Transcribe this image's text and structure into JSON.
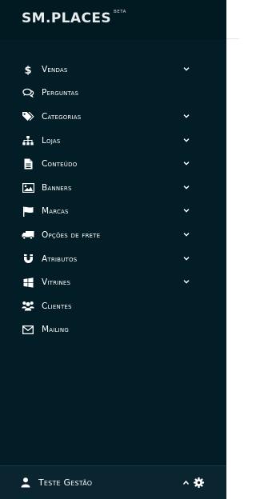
{
  "brand": {
    "logo": "SM.PLACES",
    "badge": "BETA"
  },
  "menu": {
    "items": [
      {
        "label": "Vendas",
        "icon": "dollar-icon",
        "expandable": true
      },
      {
        "label": "Perguntas",
        "icon": "comments-icon",
        "expandable": false
      },
      {
        "label": "Categorias",
        "icon": "tags-icon",
        "expandable": true
      },
      {
        "label": "Lojas",
        "icon": "sitemap-icon",
        "expandable": true
      },
      {
        "label": "Conteúdo",
        "icon": "file-icon",
        "expandable": true
      },
      {
        "label": "Banners",
        "icon": "image-icon",
        "expandable": true
      },
      {
        "label": "Marcas",
        "icon": "flag-icon",
        "expandable": true
      },
      {
        "label": "Opções de frete",
        "icon": "truck-icon",
        "expandable": true
      },
      {
        "label": "Atributos",
        "icon": "magnet-icon",
        "expandable": true
      },
      {
        "label": "Vitrines",
        "icon": "windows-icon",
        "expandable": true
      },
      {
        "label": "Clientes",
        "icon": "users-icon",
        "expandable": false
      },
      {
        "label": "Mailing",
        "icon": "envelope-icon",
        "expandable": false
      }
    ]
  },
  "footer": {
    "user_name": "Teste Gestão"
  },
  "colors": {
    "sidebar_bg": "#021d26",
    "footer_bg": "#0a2530",
    "text": "#ffffff"
  }
}
